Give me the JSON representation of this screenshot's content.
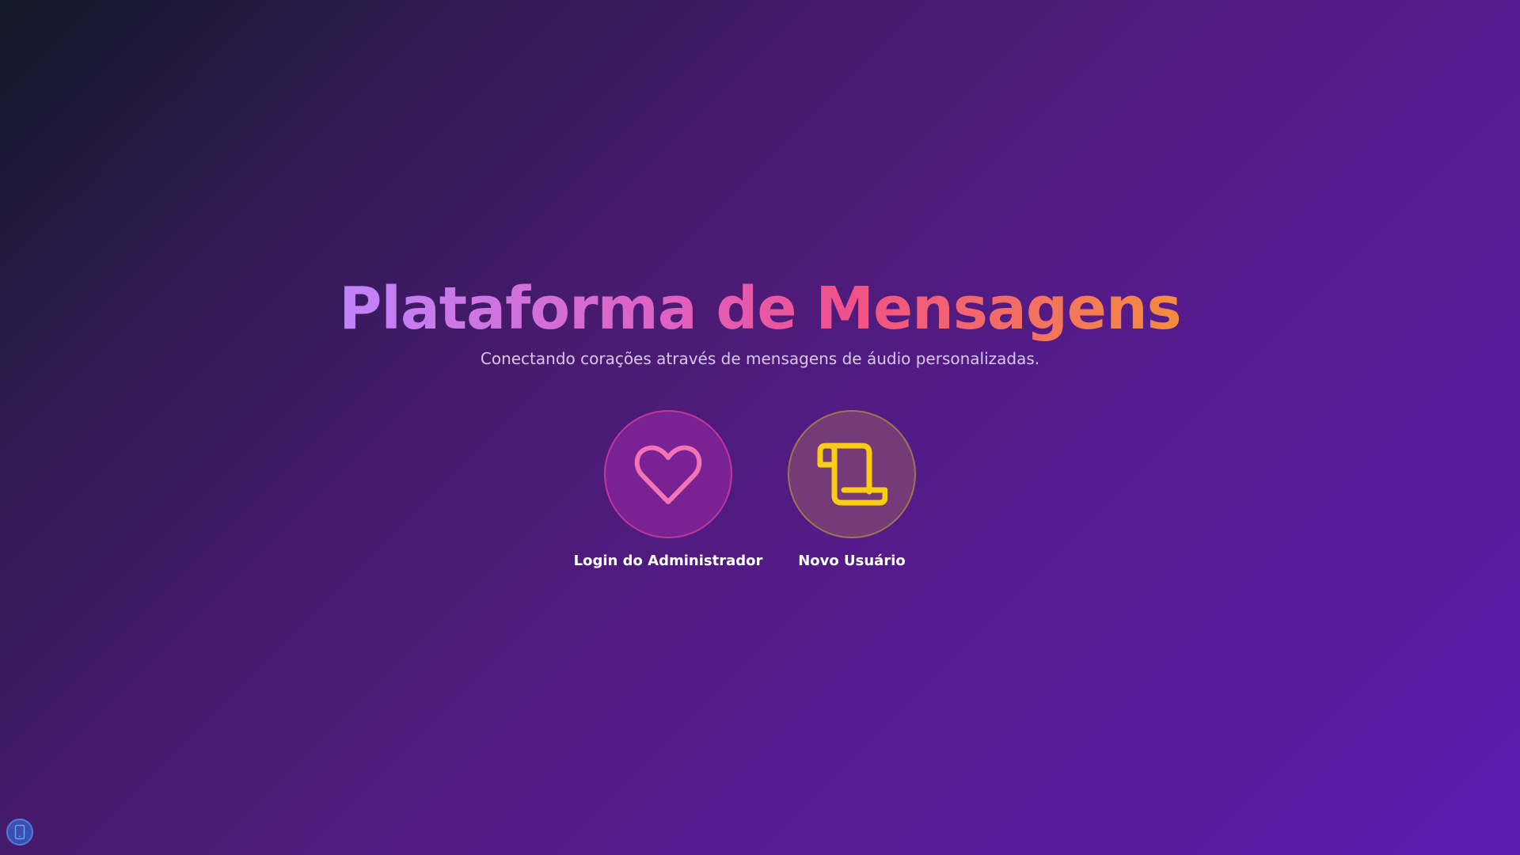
{
  "hero": {
    "title": "Plataforma de Mensagens",
    "subtitle": "Conectando corações através de mensagens de áudio personalizadas."
  },
  "actions": [
    {
      "label": "Login do Administrador",
      "icon": "heart-icon",
      "icon_color": "#f472b6"
    },
    {
      "label": "Novo Usuário",
      "icon": "scroll-icon",
      "icon_color": "#facc15"
    }
  ],
  "device_toggle": {
    "icon": "mobile-device-icon"
  },
  "colors": {
    "background_start": "#111827",
    "background_end": "#5a1cae",
    "title_gradient": [
      "#c084fc",
      "#e060c0",
      "#f0508a",
      "#f58c3e"
    ]
  }
}
